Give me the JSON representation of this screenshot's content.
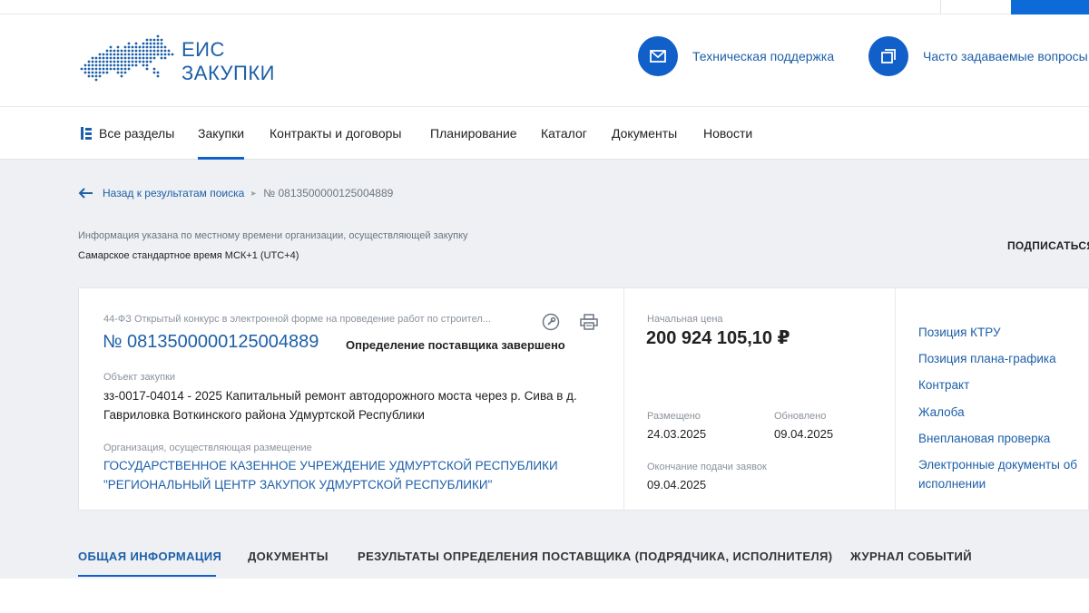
{
  "logo": {
    "line1": "ЕИС",
    "line2": "ЗАКУПКИ"
  },
  "header_links": {
    "support": {
      "label": "Техническая поддержка",
      "icon": "envelope-icon"
    },
    "faq": {
      "label": "Часто задаваемые вопросы",
      "icon": "faq-windows-icon"
    }
  },
  "nav": {
    "all_sections": "Все разделы",
    "items": [
      "Закупки",
      "Контракты и договоры",
      "Планирование",
      "Каталог",
      "Документы",
      "Новости"
    ],
    "active": "Закупки"
  },
  "breadcrumb": {
    "back": "Назад к результатам поиска",
    "current": "№ 0813500000125004889"
  },
  "timezone": {
    "info": "Информация указана по местному времени организации, осуществляющей закупку",
    "value": "Самарское стандартное время МСК+1 (UTC+4)"
  },
  "subscribe_label": "ПОДПИСАТЬСЯ",
  "purchase": {
    "type": "44-ФЗ Открытый конкурс в электронной форме на проведение работ по строител...",
    "reg_number": "№ 0813500000125004889",
    "status": "Определение поставщика завершено",
    "object_label": "Объект закупки",
    "object_value": "зз-0017-04014 - 2025 Капитальный ремонт автодорожного моста через р. Сива в д. Гавриловка Воткинского района Удмуртской Республики",
    "org_label": "Организация, осуществляющая размещение",
    "org_value": "ГОСУДАРСТВЕННОЕ КАЗЕННОЕ УЧРЕЖДЕНИЕ УДМУРТСКОЙ РЕСПУБЛИКИ \"РЕГИОНАЛЬНЫЙ ЦЕНТР ЗАКУПОК УДМУРТСКОЙ РЕСПУБЛИКИ\"",
    "price_label": "Начальная цена",
    "price_value": "200 924 105,10 ₽",
    "placed_label": "Размещено",
    "placed_value": "24.03.2025",
    "updated_label": "Обновлено",
    "updated_value": "09.04.2025",
    "deadline_label": "Окончание подачи заявок",
    "deadline_value": "09.04.2025"
  },
  "side_links": [
    "Позиция КТРУ",
    "Позиция плана-графика",
    "Контракт",
    "Жалоба",
    "Внеплановая проверка",
    "Электронные документы об",
    "исполнении"
  ],
  "tabs": [
    "ОБЩАЯ ИНФОРМАЦИЯ",
    "ДОКУМЕНТЫ",
    "РЕЗУЛЬТАТЫ ОПРЕДЕЛЕНИЯ ПОСТАВЩИКА (ПОДРЯДЧИКА, ИСПОЛНИТЕЛЯ)",
    "ЖУРНАЛ СОБЫТИЙ"
  ],
  "active_tab": "ОБЩАЯ ИНФОРМАЦИЯ",
  "colors": {
    "accent": "#1160c9",
    "link": "#1d5fa8",
    "background": "#eef0f3"
  }
}
